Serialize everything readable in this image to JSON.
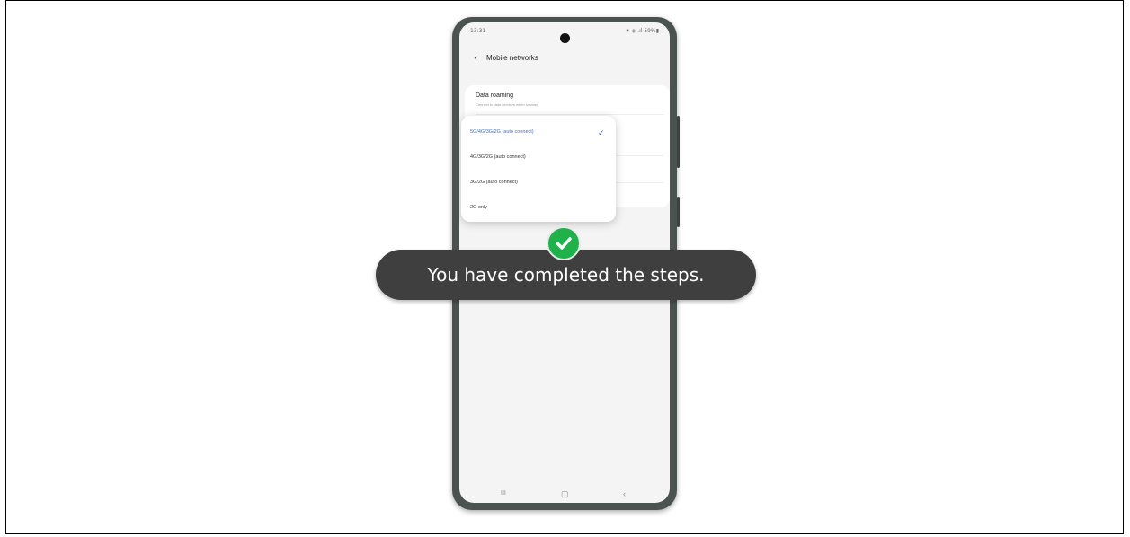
{
  "status_bar": {
    "time": "13:31",
    "icons": "✶ ◈ .ıl 59%▮"
  },
  "header": {
    "title": "Mobile networks",
    "back_icon": "chevron-left-icon"
  },
  "settings": {
    "data_roaming": {
      "title": "Data roaming",
      "subtitle": "Connect to data services when roaming"
    }
  },
  "network_mode_dropdown": {
    "options": [
      {
        "label": "5G/4G/3G/2G (auto connect)",
        "selected": true
      },
      {
        "label": "4G/3G/2G (auto connect)",
        "selected": false
      },
      {
        "label": "3G/2G (auto connect)",
        "selected": false
      },
      {
        "label": "2G only",
        "selected": false
      }
    ],
    "check_icon": "checkmark-icon"
  },
  "nav_bar": {
    "recents": "III",
    "home": "▢",
    "back": "‹"
  },
  "toast": {
    "message": "You have completed the steps.",
    "icon": "check-circle-icon"
  },
  "colors": {
    "toast_bg": "#3f3f3f",
    "check_green": "#1fb24a",
    "selected_blue": "#3d6fc4",
    "phone_frame": "#4a5350"
  }
}
